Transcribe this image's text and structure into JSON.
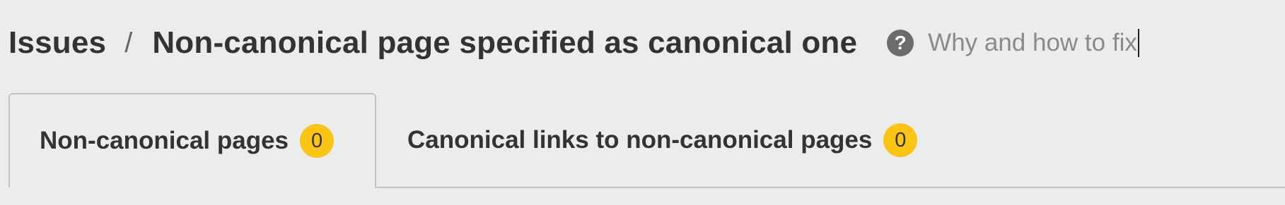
{
  "breadcrumb": {
    "root": "Issues",
    "separator": "/",
    "current": "Non-canonical page specified as canonical one"
  },
  "help": {
    "icon": "question-circle-icon",
    "label": "Why and how to fix"
  },
  "tabs": [
    {
      "label": "Non-canonical pages",
      "count": "0",
      "active": true
    },
    {
      "label": "Canonical links to non-canonical pages",
      "count": "0",
      "active": false
    }
  ],
  "colors": {
    "background": "#ebecee",
    "badge": "#fac515",
    "text": "#333333",
    "muted": "#8a8a8a"
  }
}
